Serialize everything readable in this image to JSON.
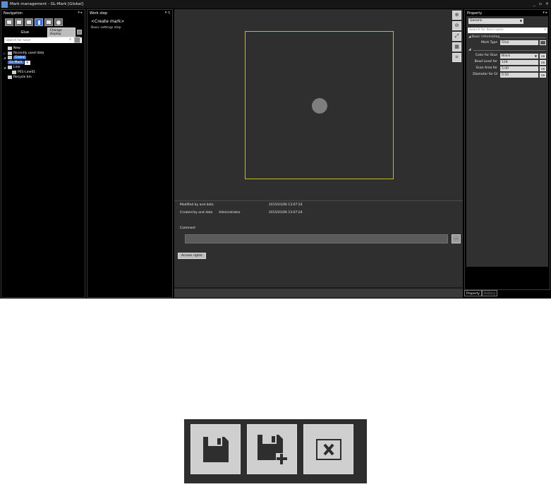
{
  "window": {
    "title": "Mark management - GL-Mark [Global]",
    "controls": [
      "_",
      "▫",
      "×"
    ]
  },
  "navigation": {
    "header": "Navigation",
    "header_ctrl": "▾ ▸",
    "glue_label": "Glue",
    "change_display": "Change display",
    "search_placeholder": "Search for Glue",
    "tree": [
      {
        "label": "New",
        "arrow": ""
      },
      {
        "label": "Recently used data",
        "arrow": "▷"
      },
      {
        "label": "Global",
        "arrow": "◢"
      },
      {
        "label": "GL-Mark",
        "arrow": ""
      },
      {
        "label": "Line",
        "arrow": "◢"
      },
      {
        "label": "P01-Line01",
        "arrow": ""
      },
      {
        "label": "Recycle bin",
        "arrow": ""
      }
    ]
  },
  "workstep": {
    "header": "Work step",
    "header_ctrl": "▾ ŋ",
    "create_mark": "<Create mark>",
    "basic_settings": "Basic settings step"
  },
  "canvas": {
    "tools": [
      "⊕",
      "⊖",
      "⤢",
      "▦",
      "⌗"
    ]
  },
  "info": {
    "modified_label": "Modified by and data",
    "modified_date": "2015/01/06 13:07:24",
    "created_label": "Created by and data",
    "created_by": "Administrator",
    "created_date": "2015/01/06 13:07:24",
    "comment_label": "Comment",
    "ellipsis": "...",
    "access_rights": "Access rights"
  },
  "property": {
    "header": "Property",
    "header_ctrl": "▾ ▸",
    "category": "Generic",
    "search_placeholder": "Search for Item name",
    "section": "Basic Information",
    "mark_type_label": "Mark Type",
    "mark_type_value": "Glue",
    "fields": [
      {
        "label": "Color for Glue",
        "value": "Black",
        "or": "OR"
      },
      {
        "label": "Bead Level for",
        "value": "128",
        "or": "OR"
      },
      {
        "label": "Scan Area for",
        "value": "5.00",
        "or": "OR"
      },
      {
        "label": "Diameter for Gl",
        "value": "0.50",
        "or": "OR"
      }
    ],
    "tabs": [
      "Property",
      "History"
    ]
  },
  "toolbar": {
    "buttons": [
      "save-icon",
      "save-as-new-icon",
      "close-icon"
    ]
  }
}
